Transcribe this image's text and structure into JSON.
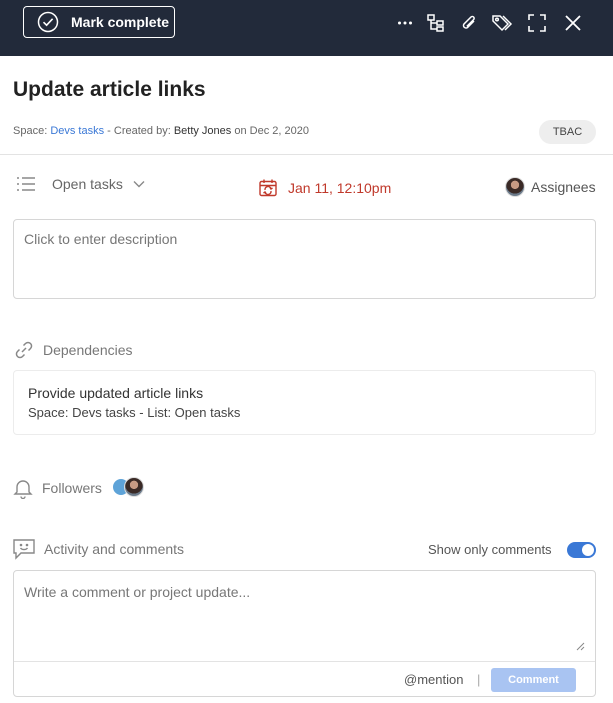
{
  "toolbar": {
    "mark_complete_label": "Mark complete",
    "icons": [
      "more-icon",
      "subtasks-icon",
      "attachment-icon",
      "tag-icon",
      "expand-icon",
      "close-icon"
    ]
  },
  "task": {
    "title": "Update article links",
    "meta": {
      "space_prefix": "Space: ",
      "space_name": "Devs tasks",
      "created_by_prefix": " - Created by: ",
      "creator": "Betty Jones",
      "date_text": " on Dec 2, 2020"
    },
    "badge": "TBAC",
    "list_label": "Open tasks",
    "due_date": "Jan 11, 12:10pm",
    "assignees_label": "Assignees",
    "description_placeholder": "Click to enter description"
  },
  "dependencies": {
    "header": "Dependencies",
    "items": [
      {
        "title": "Provide updated article links",
        "subtitle": "Space: Devs tasks - List: Open tasks"
      }
    ]
  },
  "followers": {
    "header": "Followers"
  },
  "activity": {
    "header": "Activity and comments",
    "show_only_comments_label": "Show only comments",
    "show_only_comments": true,
    "comment_placeholder": "Write a comment or project update...",
    "mention_label": "@mention",
    "separator": "|",
    "comment_button": "Comment"
  },
  "colors": {
    "topbar": "#222a3a",
    "link": "#3a78d6",
    "due_date": "#c0392b",
    "comment_button": "#a9c4f2"
  }
}
